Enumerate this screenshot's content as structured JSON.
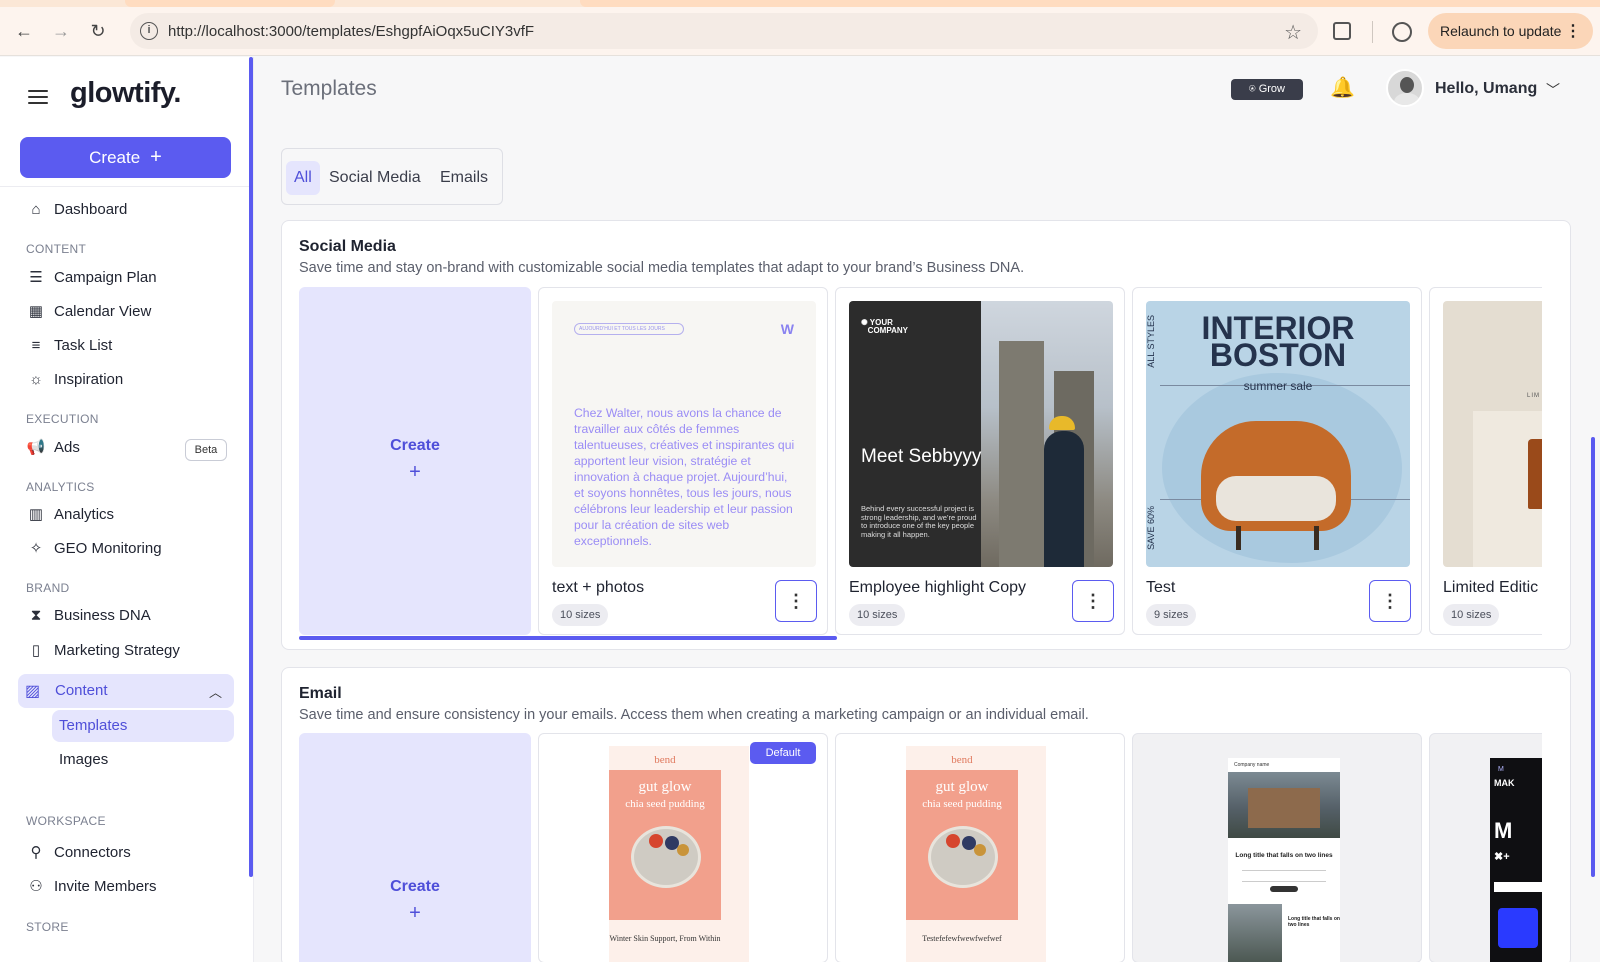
{
  "browser": {
    "url": "http://localhost:3000/templates/EshgpfAiOqx5uCIY3vfF",
    "relaunch_label": "Relaunch to update"
  },
  "sidebar": {
    "logo": "glowtify.",
    "create_label": "Create",
    "dashboard": "Dashboard",
    "sections": {
      "content": "CONTENT",
      "execution": "EXECUTION",
      "analytics": "ANALYTICS",
      "brand": "BRAND",
      "workspace": "WORKSPACE",
      "store": "STORE"
    },
    "items": {
      "campaign_plan": "Campaign Plan",
      "calendar_view": "Calendar View",
      "task_list": "Task List",
      "inspiration": "Inspiration",
      "ads": "Ads",
      "ads_badge": "Beta",
      "analytics": "Analytics",
      "geo_monitoring": "GEO Monitoring",
      "business_dna": "Business DNA",
      "marketing_strategy": "Marketing Strategy",
      "content": "Content",
      "templates": "Templates",
      "images": "Images",
      "connectors": "Connectors",
      "invite_members": "Invite Members"
    }
  },
  "header": {
    "title": "Templates",
    "grow_label": "Grow",
    "greeting": "Hello, Umang"
  },
  "filters": [
    "All",
    "Social Media",
    "Emails"
  ],
  "social": {
    "title": "Social Media",
    "description": "Save time and stay on-brand with customizable social media templates that adapt to your brand’s Business DNA.",
    "create_label": "Create",
    "create_plus": "+",
    "templates": [
      {
        "name": "text + photos",
        "sizes": "10 sizes"
      },
      {
        "name": "Employee highlight Copy",
        "sizes": "10 sizes"
      },
      {
        "name": "Test",
        "sizes": "9 sizes"
      },
      {
        "name": "Limited Editic",
        "sizes": "10 sizes"
      }
    ],
    "thumb_text": {
      "pill": "AUJOURD’HUI ET TOUS LES JOURS",
      "mark": "W",
      "paragraph": "Chez Walter, nous avons la chance de travailler aux côtés de femmes talentueuses, créatives et inspirantes qui apportent leur vision, stratégie et innovation à chaque projet. Aujourd’hui, et soyons honnêtes, tous les jours, nous célébrons leur leadership et leur passion pour la création de sites web exceptionnels."
    },
    "thumb_employee": {
      "logo_line1": "YOUR",
      "logo_line2": "COMPANY",
      "headline": "Meet Sebbyyy",
      "body": "Behind every successful project is strong leadership, and we’re proud to introduce one of the key people making it all happen."
    },
    "thumb_interior": {
      "title": "INTERIOR BOSTON",
      "subtitle": "summer sale",
      "side_top": "ALL STYLES",
      "side_bottom": "SAVE 60%"
    },
    "thumb_limited": {
      "label": "LIM"
    }
  },
  "email": {
    "title": "Email",
    "description": "Save time and ensure consistency in your emails. Access them when creating a marketing campaign or an individual email.",
    "create_label": "Create",
    "create_plus": "+",
    "default_badge": "Default",
    "bend1": {
      "brand": "bend",
      "headline": "gut glow",
      "sub": "chia seed pudding",
      "footer": "Winter Skin Support, From Within"
    },
    "bend2": {
      "brand": "bend",
      "headline": "gut glow",
      "sub": "chia seed pudding",
      "footer": "Testefefewfwewfwefwef"
    },
    "house": {
      "header": "Company name",
      "title": "Long title that falls on two lines",
      "title2": "Long title that falls on two lines"
    },
    "dark": {
      "a": "M",
      "b": "MAK",
      "c": "M",
      "d": "✖+"
    }
  }
}
